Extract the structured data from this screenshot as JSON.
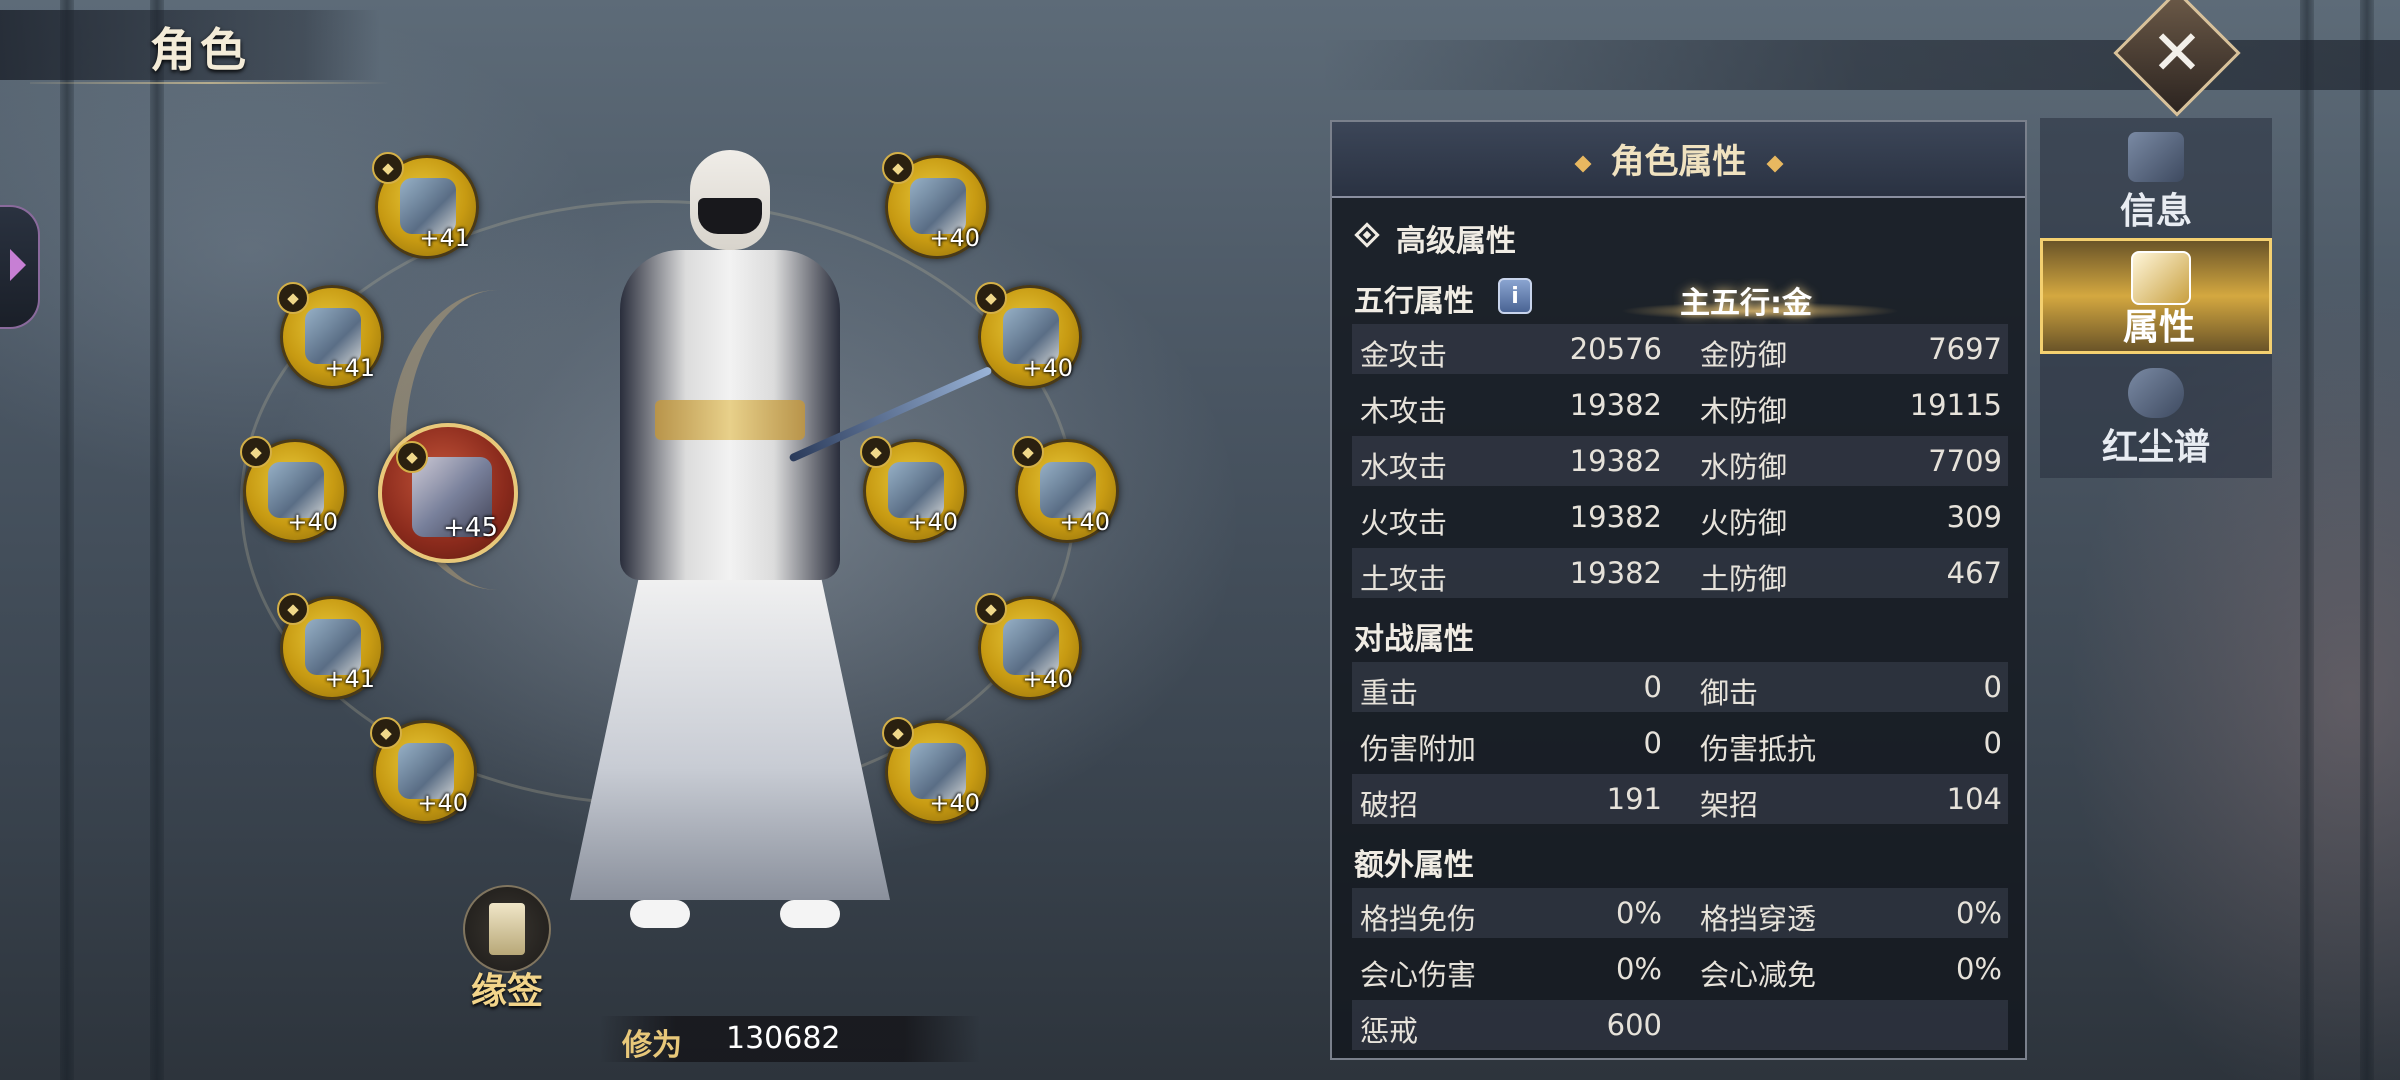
{
  "header": {
    "title": "角色",
    "close_icon": "close-icon"
  },
  "equipment": {
    "left": [
      {
        "name": "bracelet",
        "level": "+41"
      },
      {
        "name": "ring",
        "level": "+41"
      },
      {
        "name": "necklace",
        "level": "+40"
      },
      {
        "name": "pendant",
        "level": "+41"
      },
      {
        "name": "amulet",
        "level": "+40"
      }
    ],
    "weapon": {
      "name": "weapon",
      "level": "+45"
    },
    "right": [
      {
        "name": "helmet",
        "level": "+40"
      },
      {
        "name": "shoulder",
        "level": "+40"
      },
      {
        "name": "armor",
        "level": "+40"
      },
      {
        "name": "belt",
        "level": "+40"
      },
      {
        "name": "pants",
        "level": "+40"
      },
      {
        "name": "boots",
        "level": "+40"
      }
    ]
  },
  "yuanqian": {
    "label": "缘签"
  },
  "xiuwei": {
    "label": "修为",
    "value": "130682"
  },
  "panel": {
    "title": "角色属性",
    "advanced": "高级属性",
    "wuxing": {
      "label": "五行属性",
      "info": "i",
      "main": "主五行:金",
      "rows": [
        {
          "a": "金攻击",
          "av": "20576",
          "b": "金防御",
          "bv": "7697"
        },
        {
          "a": "木攻击",
          "av": "19382",
          "b": "木防御",
          "bv": "19115"
        },
        {
          "a": "水攻击",
          "av": "19382",
          "b": "水防御",
          "bv": "7709"
        },
        {
          "a": "火攻击",
          "av": "19382",
          "b": "火防御",
          "bv": "309"
        },
        {
          "a": "土攻击",
          "av": "19382",
          "b": "土防御",
          "bv": "467"
        }
      ]
    },
    "combat": {
      "label": "对战属性",
      "rows": [
        {
          "a": "重击",
          "av": "0",
          "b": "御击",
          "bv": "0"
        },
        {
          "a": "伤害附加",
          "av": "0",
          "b": "伤害抵抗",
          "bv": "0"
        },
        {
          "a": "破招",
          "av": "191",
          "b": "架招",
          "bv": "104"
        }
      ]
    },
    "extra": {
      "label": "额外属性",
      "rows": [
        {
          "a": "格挡免伤",
          "av": "0%",
          "b": "格挡穿透",
          "bv": "0%"
        },
        {
          "a": "会心伤害",
          "av": "0%",
          "b": "会心减免",
          "bv": "0%"
        },
        {
          "a": "惩戒",
          "av": "600",
          "b": "",
          "bv": ""
        }
      ]
    }
  },
  "tabs": [
    {
      "label": "信息",
      "icon": "scroll-icon"
    },
    {
      "label": "属性",
      "icon": "profile-card-icon"
    },
    {
      "label": "红尘谱",
      "icon": "cloud-icon"
    }
  ],
  "colors": {
    "accent_gold": "#e8c87a",
    "panel_bg": "#14181f",
    "slot_gold": "#c79a12"
  }
}
